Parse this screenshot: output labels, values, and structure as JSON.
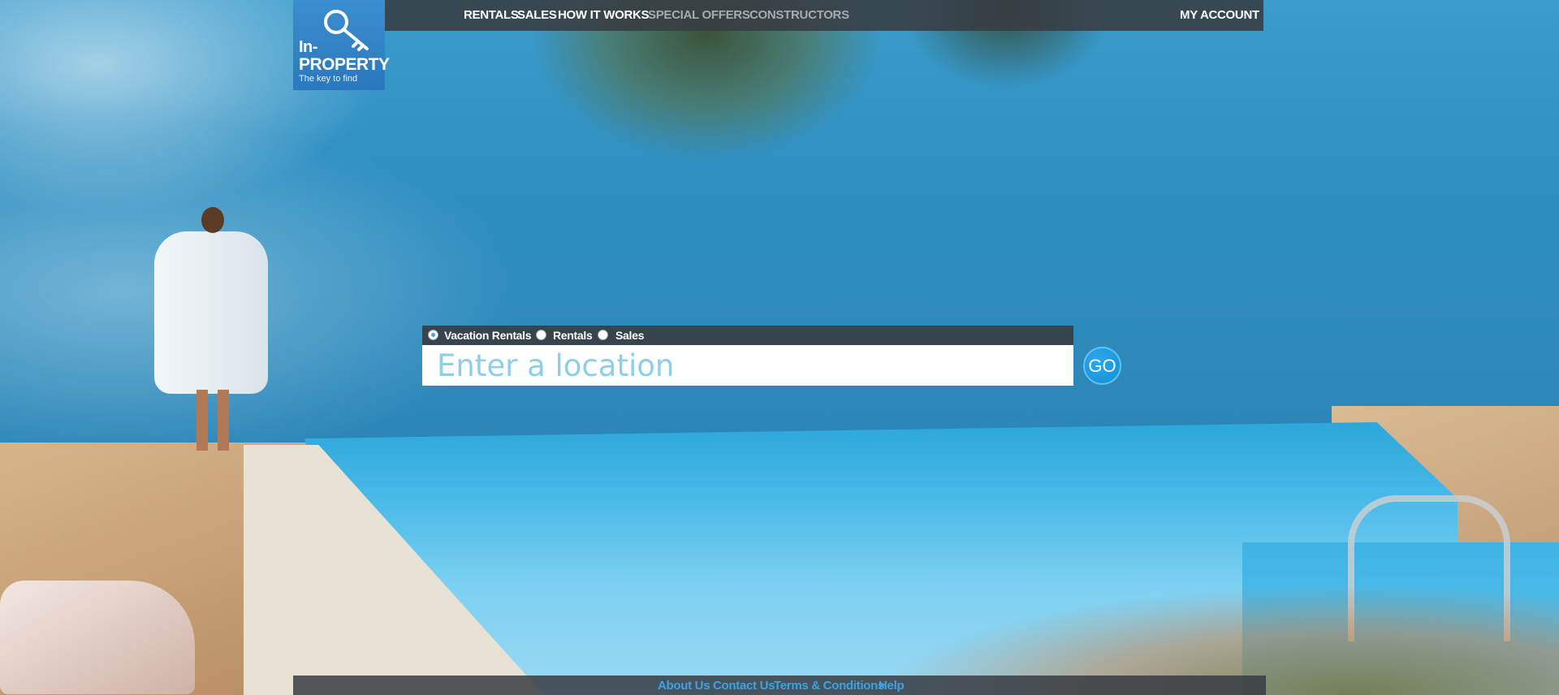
{
  "brand": {
    "name_line1": "In-",
    "name_line2": "PROPERTY",
    "tagline": "The key to find"
  },
  "nav": {
    "items": [
      {
        "label": "RENTALS",
        "active": true
      },
      {
        "label": "SALES",
        "active": true
      },
      {
        "label": "HOW IT WORKS",
        "active": true
      },
      {
        "label": "SPECIAL OFFERS",
        "active": false
      },
      {
        "label": "CONSTRUCTORS",
        "active": false
      }
    ],
    "account": "MY ACCOUNT"
  },
  "search": {
    "options": [
      {
        "label": "Vacation Rentals",
        "selected": true
      },
      {
        "label": "Rentals",
        "selected": false
      },
      {
        "label": "Sales",
        "selected": false
      }
    ],
    "placeholder": "Enter a location",
    "value": "",
    "go_label": "GO"
  },
  "footer": {
    "links": [
      "About Us",
      "Contact Us",
      "Terms & Conditions",
      "Help"
    ]
  },
  "colors": {
    "accent": "#2a78bd",
    "bar": "#373c42",
    "link": "#3aa3e4",
    "input_text": "#8ecfe8"
  },
  "icons": [
    "key-icon"
  ]
}
